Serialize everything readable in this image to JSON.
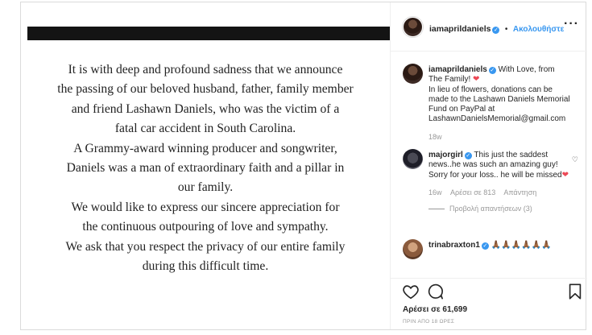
{
  "post": {
    "statement_lines": [
      "It is with deep and profound sadness that we announce",
      "the passing of our beloved husband, father, family member",
      "and friend Lashawn Daniels, who was the victim of a",
      "fatal car accident in South Carolina.",
      "A Grammy-award winning producer and songwriter,",
      "Daniels was a man of extraordinary faith and a pillar in",
      "our family.",
      "We would like to express our sincere appreciation for",
      "the continuous outpouring of love and sympathy.",
      "We ask that you respect the privacy of our entire family",
      "during this difficult time."
    ]
  },
  "header": {
    "username": "iamaprildaniels",
    "separator": "•",
    "follow_label": "Ακολουθήστε",
    "more_icon": "more-icon"
  },
  "caption": {
    "username": "iamaprildaniels",
    "text": "With Love, from The Family!",
    "heart": "❤",
    "text2": "In lieu of flowers, donations can be made to the Lashawn Daniels Memorial Fund on PayPal at LashawnDanielsMemorial@gmail.com",
    "time": "18w"
  },
  "comments": [
    {
      "username": "majorgirl",
      "text": "This just the saddest news..he was such an amazing guy! Sorry for your loss.. he will be missed",
      "heart": "❤",
      "time": "16w",
      "likes": "Αρέσει σε 813",
      "reply": "Απάντηση",
      "view_replies": "Προβολή απαντήσεων (3)"
    },
    {
      "username": "trinabraxton1",
      "text": "🙏🏾🙏🏾🙏🏾🙏🏾🙏🏾🙏🏾"
    }
  ],
  "footer": {
    "likes": "Αρέσει σε 61,699",
    "time": "ΠΡΙΝ ΑΠΟ 18 ΩΡΕΣ"
  },
  "colors": {
    "accent": "#3897f0",
    "heart": "#ed4956",
    "muted": "#999999"
  }
}
